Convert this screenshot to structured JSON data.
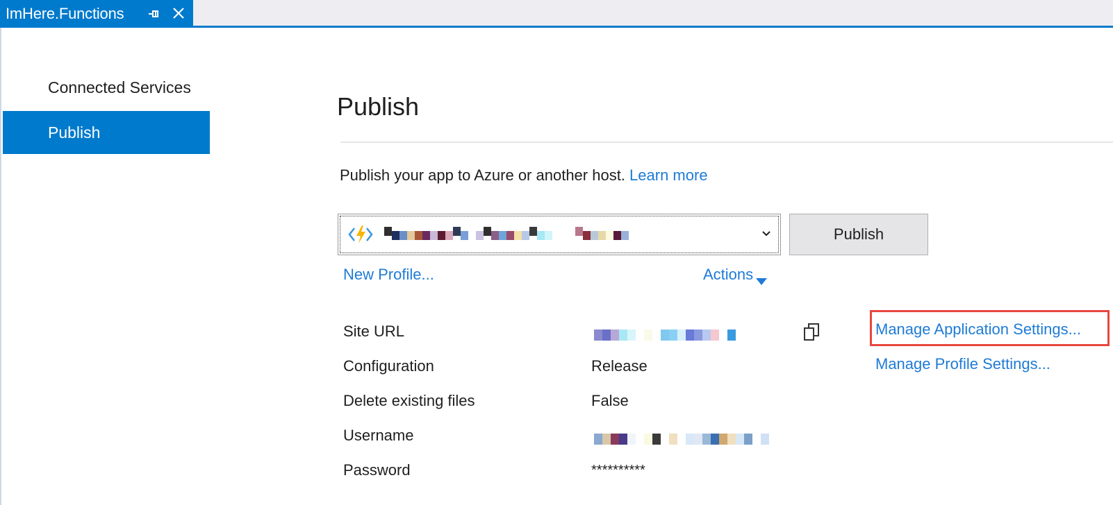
{
  "tab": {
    "title": "ImHere.Functions",
    "pin_icon": "pin-icon",
    "close_icon": "close-icon"
  },
  "sidebar": {
    "items": [
      {
        "label": "Connected Services",
        "selected": false
      },
      {
        "label": "Publish",
        "selected": true
      }
    ]
  },
  "main": {
    "title": "Publish",
    "intro_text": "Publish your app to Azure or another host.",
    "learn_more": "Learn more",
    "profile_icon": "azure-functions-icon",
    "publish_button": "Publish",
    "new_profile": "New Profile...",
    "actions": "Actions",
    "details": {
      "site_url_label": "Site URL",
      "configuration_label": "Configuration",
      "configuration_value": "Release",
      "delete_label": "Delete existing files",
      "delete_value": "False",
      "username_label": "Username",
      "password_label": "Password",
      "password_value": "**********"
    },
    "manage_app_settings": "Manage Application Settings...",
    "manage_profile_settings": "Manage Profile Settings..."
  },
  "colors": {
    "accent": "#007acc",
    "link": "#1e7bd6",
    "highlight_box": "#e8463e",
    "azure_functions_icon": "#f7b500"
  }
}
